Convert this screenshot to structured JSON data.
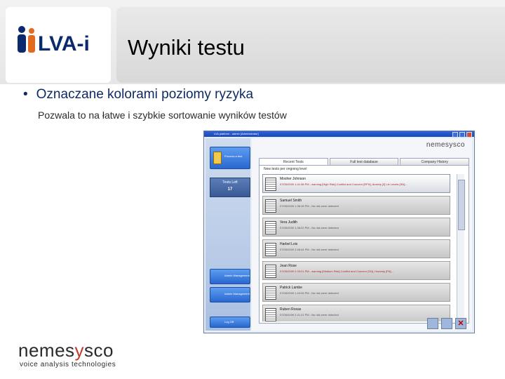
{
  "header": {
    "title": "Wyniki testu",
    "logo_text": "LVA-i"
  },
  "content": {
    "bullet": "Oznaczane kolorami poziomy ryzyka",
    "subtext": "Pozwala to na łatwe i szybkie sortowanie wyników testów"
  },
  "screenshot": {
    "window_title": "LVA platform - admin [Administrator]",
    "brand": "nemesysco",
    "left_pane": {
      "new_test_label": "Process a test",
      "tests_left_label": "Tests Left",
      "tests_left_value": "17",
      "btn2_label": "Admin Management",
      "btn3_label": "Admin Management",
      "logoff_label": "Log Off"
    },
    "tabs": [
      {
        "label": "Recent Tests",
        "active": true
      },
      {
        "label": "Full test database",
        "active": false
      },
      {
        "label": "Company History",
        "active": false
      }
    ],
    "list_caption": "New tests per ongoing level",
    "rows": [
      {
        "name": "Mosher Johnson",
        "info": "07/05/2009 1:41:38 PM - warning [High Risk] Conflict and Concern [RFN], Anxiety [2] Lie Levels [SN]...",
        "risk": true
      },
      {
        "name": "Samuel Smith",
        "info": "07/05/2009 1:36:18 PM - No risk were detected",
        "risk": false
      },
      {
        "name": "Vera Judith",
        "info": "07/05/2009 1:38:22 PM - No risk were detected",
        "risk": false
      },
      {
        "name": "Harbel Lois",
        "info": "07/05/2009 2:48:44 PM - No risk were detected",
        "risk": false
      },
      {
        "name": "Jean Rose",
        "info": "07/05/2009 2:33:01 PM - warning [Medium Risk] Conflict and Concern [SN], Honesty [FN]...",
        "risk": true
      },
      {
        "name": "Patrick Lambe",
        "info": "07/05/2009 1:43:05 PM - No risk were detected",
        "risk": false
      },
      {
        "name": "Ruben Roxas",
        "info": "07/05/2009 2:41:21 PM - No risk were detected",
        "risk": false
      }
    ]
  },
  "footer": {
    "brand_a": "nemes",
    "brand_b": "y",
    "brand_c": "sco",
    "tagline": "voice analysis technologies"
  },
  "icons": {
    "logo": "lva-people-icon",
    "doc": "document-icon",
    "delete": "close-icon",
    "folder": "folder-icon",
    "print": "printer-icon"
  },
  "colors": {
    "title_text": "#000000",
    "bullet_text": "#0e2a63",
    "risk_text": "#b3261e",
    "brand_accent": "#c23a2b"
  }
}
